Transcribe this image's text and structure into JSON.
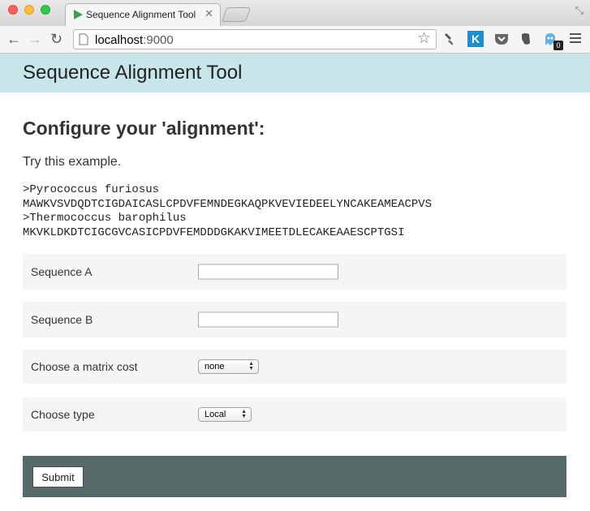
{
  "browser": {
    "tab_title": "Sequence Alignment Tool",
    "tab_close": "✕",
    "url_host": "localhost",
    "url_port": ":9000",
    "extension_k_label": "K",
    "badge_count": "0",
    "icons": [
      "back-arrow-icon",
      "forward-arrow-icon",
      "reload-icon",
      "star-icon",
      "brush-icon",
      "pocket-icon",
      "evernote-icon",
      "ghost-icon",
      "menu-icon"
    ]
  },
  "header": {
    "title": "Sequence Alignment Tool"
  },
  "main": {
    "heading": "Configure your 'alignment':",
    "example_intro": "Try this example.",
    "example_lines": [
      ">Pyrococcus furiosus",
      "MAWKVSVDQDTCIGDAICASLCPDVFEMNDEGKAQPKVEVIEDEELYNCAKEAMEACPVS",
      ">Thermococcus barophilus",
      "MKVKLDKDTCIGCGVCASICPDVFEMDDDGKAKVIMEETDLECAKEAAESCPTGSI"
    ]
  },
  "form": {
    "sequence_a": {
      "label": "Sequence A",
      "value": ""
    },
    "sequence_b": {
      "label": "Sequence B",
      "value": ""
    },
    "matrix_cost": {
      "label": "Choose a matrix cost",
      "selected": "none"
    },
    "type": {
      "label": "Choose type",
      "selected": "Local"
    },
    "submit_label": "Submit"
  },
  "colors": {
    "header_bg": "#c8e6ea",
    "row_bg": "#f5f5f5",
    "submit_bar_bg": "#556a69"
  }
}
